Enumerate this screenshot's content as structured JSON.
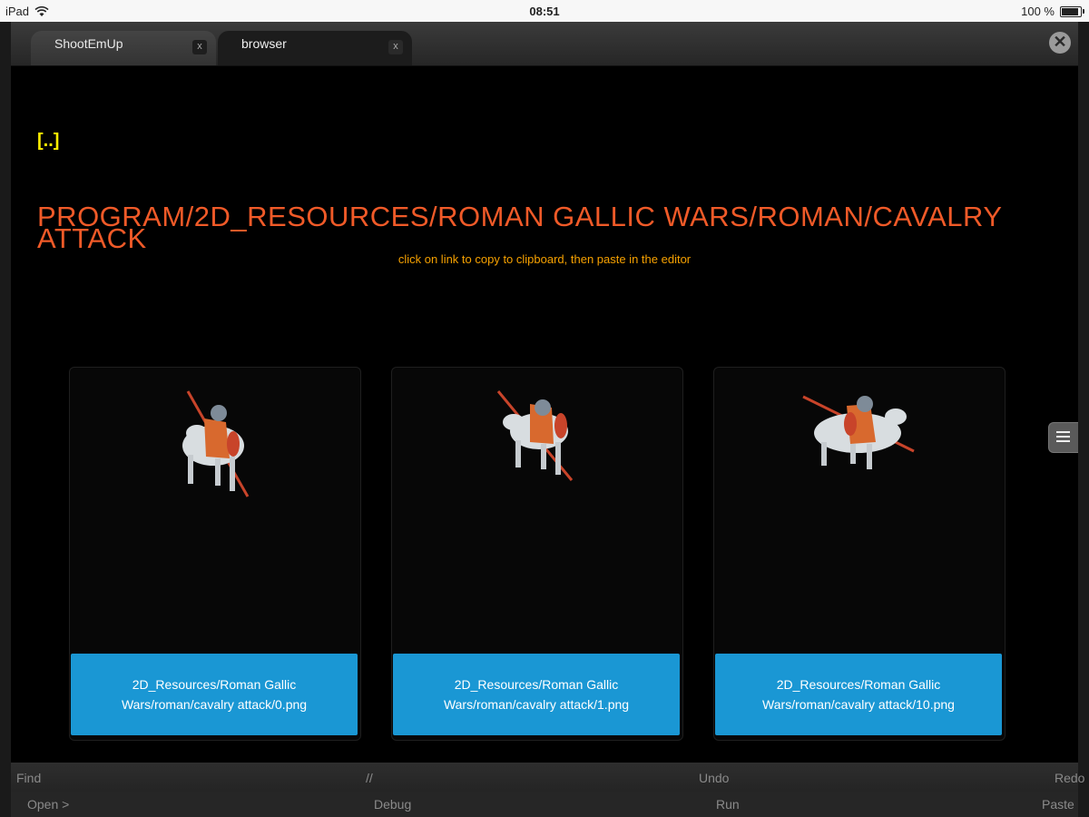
{
  "status_bar": {
    "device": "iPad",
    "time": "08:51",
    "battery": "100 %",
    "battery_level": 1.0
  },
  "tabs": [
    {
      "label": "ShootEmUp",
      "close": "x"
    },
    {
      "label": "browser",
      "close": "x",
      "active": true
    }
  ],
  "window_close": "✕",
  "browser": {
    "parent_link": "[..]",
    "path_title": "PROGRAM/2D_RESOURCES/ROMAN GALLIC WARS/ROMAN/CAVALRY ATTACK",
    "hint": "click on link to copy to clipboard, then paste in the editor",
    "files": [
      {
        "link": "2D_Resources/Roman Gallic Wars/roman/cavalry attack/0.png"
      },
      {
        "link": "2D_Resources/Roman Gallic Wars/roman/cavalry attack/1.png"
      },
      {
        "link": "2D_Resources/Roman Gallic Wars/roman/cavalry attack/10.png"
      }
    ]
  },
  "toolbar": {
    "row1": {
      "find": "Find",
      "comment": "//",
      "undo": "Undo",
      "redo": "Redo"
    },
    "row2": {
      "open": "Open >",
      "debug": "Debug",
      "run": "Run",
      "paste": "Paste"
    }
  },
  "colors": {
    "path_title": "#f05a28",
    "parent_link": "#ffee00",
    "hint": "#f5a000",
    "link_button": "#1a97d4"
  }
}
